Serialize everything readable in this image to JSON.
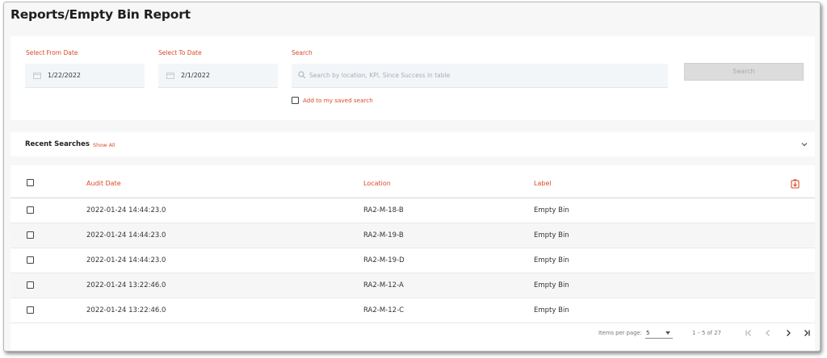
{
  "page": {
    "title": "Reports/Empty Bin Report"
  },
  "filters": {
    "from_label": "Select From Date",
    "from_value": "1/22/2022",
    "to_label": "Select To Date",
    "to_value": "2/1/2022",
    "search_label": "Search",
    "search_placeholder": "Search by location, KPI, Since Success in table",
    "search_button": "Search",
    "save_label": "Add to my saved search"
  },
  "recent": {
    "title": "Recent Searches",
    "show_all": "Show All"
  },
  "table": {
    "columns": [
      "Audit Date",
      "Location",
      "Label"
    ],
    "rows": [
      {
        "date": "2022-01-24 14:44:23.0",
        "location": "RA2-M-18-B",
        "label": "Empty Bin"
      },
      {
        "date": "2022-01-24 14:44:23.0",
        "location": "RA2-M-19-B",
        "label": "Empty Bin"
      },
      {
        "date": "2022-01-24 14:44:23.0",
        "location": "RA2-M-19-D",
        "label": "Empty Bin"
      },
      {
        "date": "2022-01-24 13:22:46.0",
        "location": "RA2-M-12-A",
        "label": "Empty Bin"
      },
      {
        "date": "2022-01-24 13:22:46.0",
        "location": "RA2-M-12-C",
        "label": "Empty Bin"
      }
    ]
  },
  "pagination": {
    "items_per_page_label": "Items per page:",
    "items_per_page": "5",
    "range": "1 – 5 of 27"
  },
  "icons": {
    "calendar": "calendar-icon",
    "search": "search-icon",
    "chevron": "chevron-down-icon",
    "export": "export-icon",
    "first": "first-page-icon",
    "prev": "prev-page-icon",
    "next": "next-page-icon",
    "last": "last-page-icon"
  },
  "colors": {
    "accent": "#d94a2a",
    "button_disabled": "#dcdcdc"
  }
}
